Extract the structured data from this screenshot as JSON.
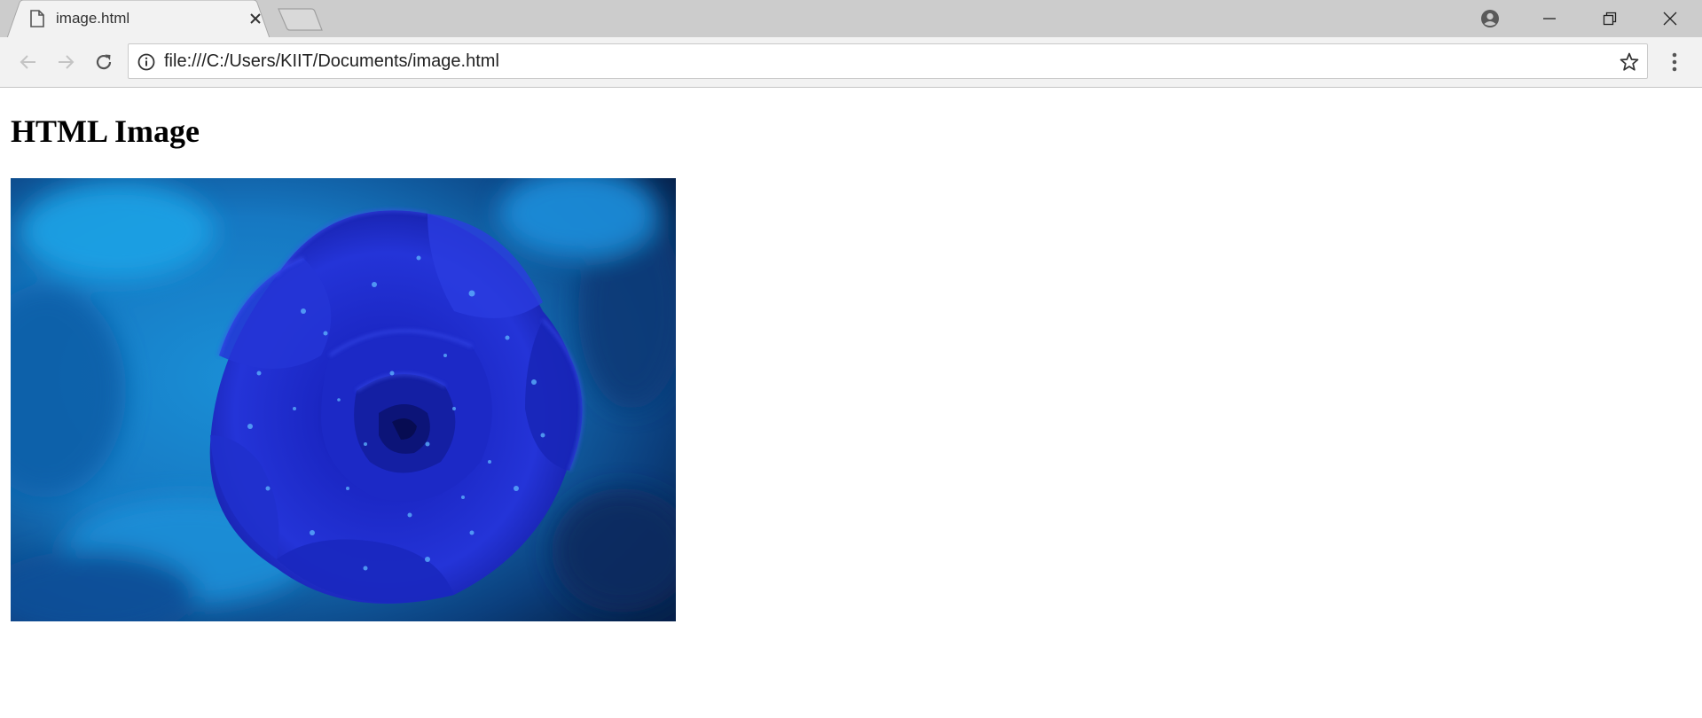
{
  "browser": {
    "tab": {
      "title": "image.html",
      "icon": "document-icon"
    },
    "address_bar": {
      "url": "file:///C:/Users/KIIT/Documents/image.html"
    },
    "colors": {
      "tab_strip": "#cccccc",
      "toolbar": "#f2f2f2"
    }
  },
  "page": {
    "heading": "HTML Image",
    "image": {
      "subject": "blue rose with water droplets",
      "colors": [
        "#1a2bc8",
        "#1e9be0",
        "#0a2a6b"
      ]
    }
  }
}
